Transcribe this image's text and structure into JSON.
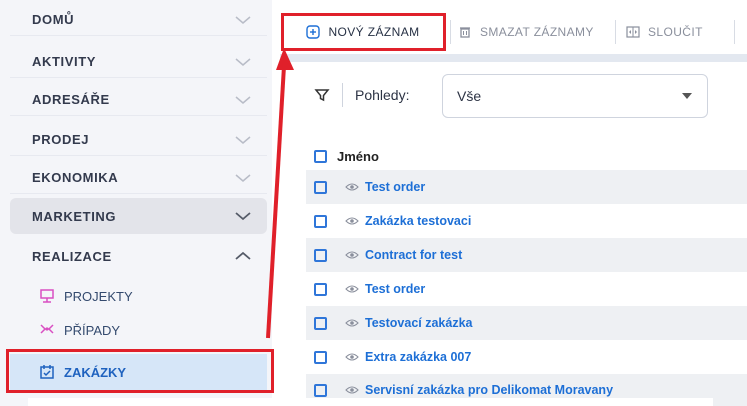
{
  "sidebar": {
    "items": [
      {
        "label": "DOMŮ",
        "state": "collapsed"
      },
      {
        "label": "AKTIVITY",
        "state": "collapsed"
      },
      {
        "label": "ADRESÁŘE",
        "state": "collapsed"
      },
      {
        "label": "PRODEJ",
        "state": "collapsed"
      },
      {
        "label": "EKONOMIKA",
        "state": "collapsed"
      },
      {
        "label": "MARKETING",
        "state": "collapsed"
      },
      {
        "label": "REALIZACE",
        "state": "expanded"
      }
    ],
    "subitems": [
      {
        "label": "PROJEKTY",
        "icon": "projects-icon"
      },
      {
        "label": "PŘÍPADY",
        "icon": "cases-icon"
      },
      {
        "label": "ZAKÁZKY",
        "icon": "orders-icon"
      }
    ]
  },
  "toolbar": {
    "new_label": "NOVÝ ZÁZNAM",
    "delete_label": "SMAZAT ZÁZNAMY",
    "merge_label": "SLOUČIT"
  },
  "filter": {
    "label": "Pohledy:",
    "selected_view": "Vše"
  },
  "table": {
    "header": "Jméno",
    "rows": [
      "Test order",
      "Zakázka testovaci",
      "Contract for test",
      "Test order",
      "Testovací zakázka",
      "Extra zakázka 007",
      "Servisní zakázka pro Delikomat Moravany"
    ]
  },
  "colors": {
    "accent": "#1d6fd6",
    "highlight": "#e0202a",
    "sidebar_bg": "#f4f5f9"
  }
}
